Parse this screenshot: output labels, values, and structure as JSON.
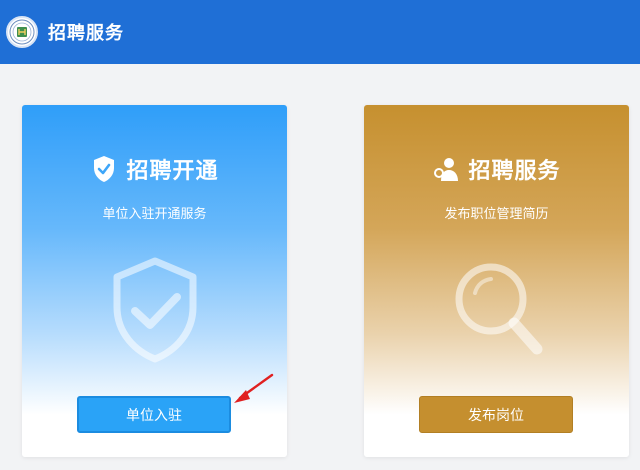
{
  "header": {
    "title": "招聘服务",
    "background": "#1f6fd6",
    "logo_icon": "university-emblem-icon"
  },
  "cards": [
    {
      "title": "招聘开通",
      "subtitle": "单位入驻开通服务",
      "icon": "shield-check-icon",
      "watermark_icon": "shield-check-icon",
      "button_label": "单位入驻",
      "accent": "#2aa3f7"
    },
    {
      "title": "招聘服务",
      "subtitle": "发布职位管理简历",
      "icon": "user-search-icon",
      "watermark_icon": "magnifier-icon",
      "button_label": "发布岗位",
      "accent": "#c58f2f"
    }
  ],
  "annotation": {
    "icon": "red-arrow-icon",
    "color": "#e02020"
  }
}
